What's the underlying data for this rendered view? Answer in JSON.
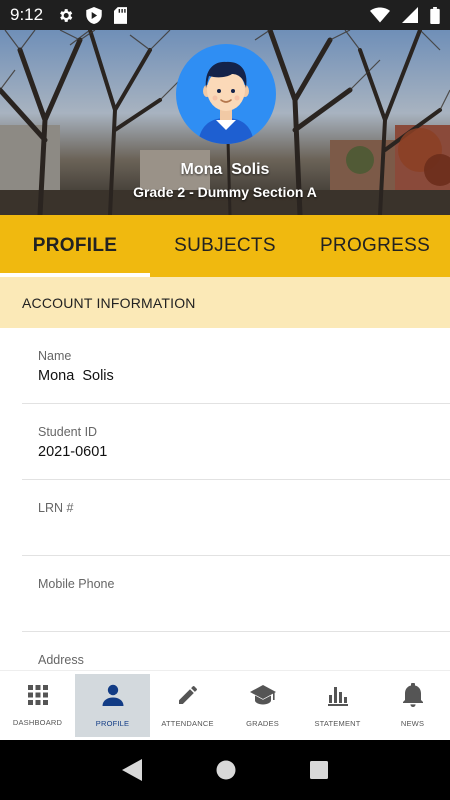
{
  "status_bar": {
    "time": "9:12",
    "left_icons": [
      "settings-icon",
      "play-protect-icon",
      "sd-card-icon"
    ],
    "right_icons": [
      "wifi-icon",
      "signal-icon",
      "battery-icon"
    ]
  },
  "profile_header": {
    "student_name": "Mona  Solis",
    "grade_section": "Grade 2 - Dummy Section A",
    "avatar": "student-avatar-icon"
  },
  "tabs": [
    {
      "label": "PROFILE",
      "active": true
    },
    {
      "label": "SUBJECTS",
      "active": false
    },
    {
      "label": "PROGRESS",
      "active": false
    }
  ],
  "section": {
    "title": "ACCOUNT INFORMATION"
  },
  "fields": [
    {
      "label": "Name",
      "value": "Mona  Solis"
    },
    {
      "label": "Student ID",
      "value": "2021-0601"
    },
    {
      "label": "LRN #",
      "value": ""
    },
    {
      "label": "Mobile Phone",
      "value": ""
    },
    {
      "label": "Address",
      "value": ""
    }
  ],
  "bottom_nav": [
    {
      "label": "DASHBOARD",
      "icon": "grid-icon",
      "active": false
    },
    {
      "label": "PROFILE",
      "icon": "person-icon",
      "active": true
    },
    {
      "label": "ATTENDANCE",
      "icon": "pencil-icon",
      "active": false
    },
    {
      "label": "GRADES",
      "icon": "graduation-cap-icon",
      "active": false
    },
    {
      "label": "STATEMENT",
      "icon": "bar-chart-icon",
      "active": false
    },
    {
      "label": "NEWS",
      "icon": "bell-icon",
      "active": false
    }
  ],
  "colors": {
    "tab_bar": "#f0b90f",
    "section_header_bg": "#fbe9b7",
    "avatar_bg": "#2f8ef3",
    "active_nav_bg": "#d3d9dd",
    "active_nav_icon": "#123c85"
  }
}
